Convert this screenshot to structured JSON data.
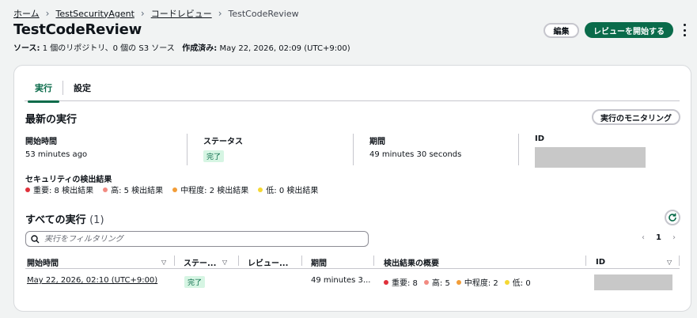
{
  "breadcrumb": [
    "ホーム",
    "TestSecurityAgent",
    "コードレビュー",
    "TestCodeReview"
  ],
  "title": "TestCodeReview",
  "meta": {
    "sources_label": "ソース:",
    "sources_value": "1 個のリポジトリ、0 個の S3 ソース",
    "created_label": "作成済み:",
    "created_value": "May 22, 2026, 02:09 (UTC+9:00)"
  },
  "actions": {
    "edit": "編集",
    "start": "レビューを開始する"
  },
  "tabs": [
    {
      "label": "実行",
      "active": true
    },
    {
      "label": "設定",
      "active": false
    }
  ],
  "latest": {
    "heading": "最新の実行",
    "monitor_button": "実行のモニタリング",
    "start_time_label": "開始時間",
    "start_time_value": "53 minutes ago",
    "status_label": "ステータス",
    "status_value": "完了",
    "duration_label": "期間",
    "duration_value": "49 minutes 30 seconds",
    "id_label": "ID",
    "security_label": "セキュリティの検出結果",
    "findings": [
      {
        "text": "重要: 8 検出結果",
        "color": "#e0303a"
      },
      {
        "text": "高: 5 検出結果",
        "color": "#f28b82"
      },
      {
        "text": "中程度: 2 検出結果",
        "color": "#f29d38"
      },
      {
        "text": "低: 0 検出結果",
        "color": "#f5d833"
      }
    ]
  },
  "all_runs": {
    "heading": "すべての実行",
    "count": "(1)",
    "filter_placeholder": "実行をフィルタリング",
    "page": "1",
    "columns": [
      "開始時間",
      "ステー...",
      "レビュー...",
      "期間",
      "検出結果の概要",
      "ID"
    ],
    "rows": [
      {
        "start": "May 22, 2026, 02:10 (UTC+9:00)",
        "status": "完了",
        "review": "",
        "duration": "49 minutes 3...",
        "summary": [
          {
            "text": "重要: 8",
            "color": "#e0303a"
          },
          {
            "text": "高: 5",
            "color": "#f28b82"
          },
          {
            "text": "中程度: 2",
            "color": "#f29d38"
          },
          {
            "text": "低: 0",
            "color": "#f5d833"
          }
        ]
      }
    ]
  },
  "colors": {
    "accent": "#0a6b4a",
    "badge_bg": "#d6f5e3"
  }
}
